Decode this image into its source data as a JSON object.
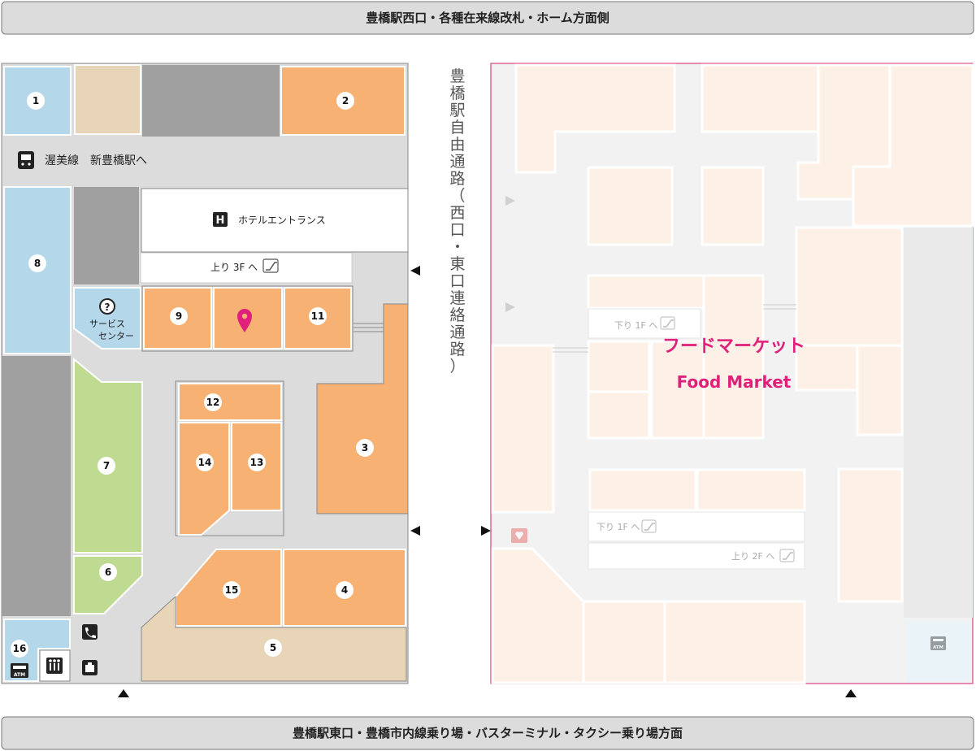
{
  "banners": {
    "top": "豊橋駅西口・各種在来線改札・ホーム方面側",
    "bottom": "豊橋駅東口・豊橋市内線乗り場・バスターミナル・タクシー乗り場方面"
  },
  "corridor_label": "豊橋駅自由通路（西口・東口連絡通路）",
  "labels": {
    "atsumi_line": "渥美線　新豊橋駅へ",
    "hotel_entrance": "ホテルエントランス",
    "hotel_icon": "H",
    "up_3f": "上り 3F へ",
    "service_center_1": "サービス",
    "service_center_2": "センター",
    "service_icon": "?",
    "food_market_ja": "フードマーケット",
    "food_market_en": "Food Market",
    "down_1f_a": "下り 1F へ",
    "down_1f_b": "下り 1F へ",
    "up_2f": "上り 2F へ",
    "atm_left": "ATM",
    "atm_right": "ATM"
  },
  "shops": [
    {
      "num": "1"
    },
    {
      "num": "2"
    },
    {
      "num": "3"
    },
    {
      "num": "4"
    },
    {
      "num": "5"
    },
    {
      "num": "6"
    },
    {
      "num": "7"
    },
    {
      "num": "8"
    },
    {
      "num": "9"
    },
    {
      "num": "11"
    },
    {
      "num": "12"
    },
    {
      "num": "13"
    },
    {
      "num": "14"
    },
    {
      "num": "15"
    },
    {
      "num": "16"
    }
  ],
  "icons": [
    "train-icon",
    "hotel-icon",
    "escalator-icon",
    "info-icon",
    "location-pin-icon",
    "phone-icon",
    "locker-icon",
    "restroom-icon",
    "atm-icon",
    "direction-arrow-icon",
    "aed-icon"
  ],
  "colors": {
    "shop_orange": "#f6b173",
    "shop_tan": "#e8d5b8",
    "shop_blue": "#b5d7ea",
    "shop_green": "#bfdb92",
    "wall_gray": "#a0a0a0",
    "floor_gray": "#dcdcdc",
    "food_market_pale": "#fdf0e6",
    "food_market_border": "#d9437f",
    "accent_pink": "#e0207a"
  }
}
